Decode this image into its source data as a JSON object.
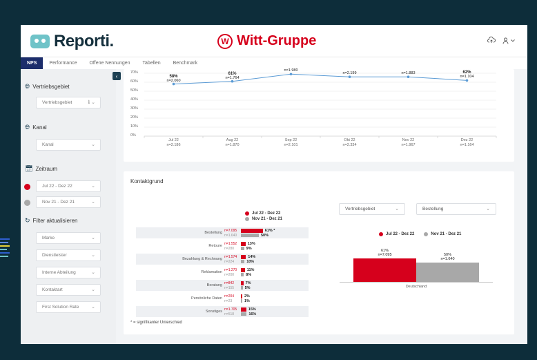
{
  "header": {
    "app_name": "Reporti.",
    "client_name": "Witt-Gruppe",
    "client_logo_letter": "W"
  },
  "nav": {
    "tabs": [
      {
        "label": "NPS",
        "active": true
      },
      {
        "label": "Performance",
        "active": false
      },
      {
        "label": "Offene Nennungen",
        "active": false
      },
      {
        "label": "Tabellen",
        "active": false
      },
      {
        "label": "Benchmark",
        "active": false
      }
    ]
  },
  "sidebar": {
    "vertriebsgebiet_heading": "Vertriebsgebiet",
    "vertriebsgebiet_select": "Vertriebsgebiet",
    "kanal_heading": "Kanal",
    "kanal_select": "Kanal",
    "zeitraum_heading": "Zeitraum",
    "period_current": "Jul 22 - Dez 22",
    "period_previous": "Nov 21 - Dez 21",
    "filter_heading": "Filter aktualisieren",
    "filters": [
      "Marke",
      "Dienstleister",
      "Interne Abteilung",
      "Kontaktart",
      "First Solution Rate"
    ],
    "toggle_icon": "chevron-left-icon"
  },
  "colors": {
    "accent_red": "#d6001c",
    "compare_gray": "#a8a8a8",
    "nav_active": "#1c2d6b",
    "line_blue": "#5b9bd5"
  },
  "chart_data": [
    {
      "type": "line",
      "yticks": [
        "70%",
        "60%",
        "50%",
        "40%",
        "30%",
        "20%",
        "10%",
        "0%"
      ],
      "ylim": [
        0,
        70
      ],
      "x": [
        "Jul 22",
        "Aug 22",
        "Sep 22",
        "Okt 22",
        "Nov 22",
        "Dez 22"
      ],
      "x_n": [
        "n=2.186",
        "n=1.870",
        "n=2.101",
        "n=2.334",
        "n=1.967",
        "n=1.164"
      ],
      "values": [
        58,
        61,
        69,
        66,
        66,
        62
      ],
      "point_labels": [
        "58%",
        "61%",
        "",
        "",
        "",
        "62%"
      ],
      "point_n": [
        "n=2.060",
        "n=1.764",
        "n=1.980",
        "n=2.199",
        "n=1.883",
        "n=1.104"
      ]
    },
    {
      "type": "bar",
      "title": "Kontaktgrund",
      "legend": [
        "Jul 22 - Dez 22",
        "Nov 21 - Dez 21"
      ],
      "categories": [
        "Bestellung",
        "Retoure",
        "Bezahlung & Rechnung",
        "Reklamation",
        "Beratung",
        "Persönliche Daten",
        "Sonstiges"
      ],
      "series": [
        {
          "name": "Jul 22 - Dez 22",
          "values": [
            61,
            13,
            14,
            11,
            7,
            2,
            15
          ],
          "n": [
            "n=7.095",
            "n=1.552",
            "n=1.574",
            "n=1.270",
            "n=842",
            "n=204",
            "n=1.705"
          ],
          "labels": [
            "61% *",
            "13%",
            "14%",
            "11%",
            "7%",
            "2%",
            "15%"
          ]
        },
        {
          "name": "Nov 21 - Dez 21",
          "values": [
            50,
            9,
            10,
            8,
            5,
            1,
            16
          ],
          "n": [
            "n=1.640",
            "n=280",
            "n=224",
            "n=200",
            "n=155",
            "n=23",
            "n=518"
          ],
          "labels": [
            "50%",
            "9%",
            "10%",
            "8%",
            "5%",
            "1%",
            "16%"
          ]
        }
      ],
      "footnote": "* = signifikanter Unterschied"
    },
    {
      "type": "bar",
      "filters": [
        "Vertriebsgebiet",
        "Bestellung"
      ],
      "legend": [
        "Jul 22 - Dez 22",
        "Nov 21 - Dez 21"
      ],
      "categories": [
        "Deutschland"
      ],
      "series": [
        {
          "name": "Jul 22 - Dez 22",
          "values": [
            61
          ],
          "label": "61%",
          "n": "n=7.095"
        },
        {
          "name": "Nov 21 - Dez 21",
          "values": [
            50
          ],
          "label": "50%",
          "n": "n=1.640"
        }
      ]
    }
  ]
}
